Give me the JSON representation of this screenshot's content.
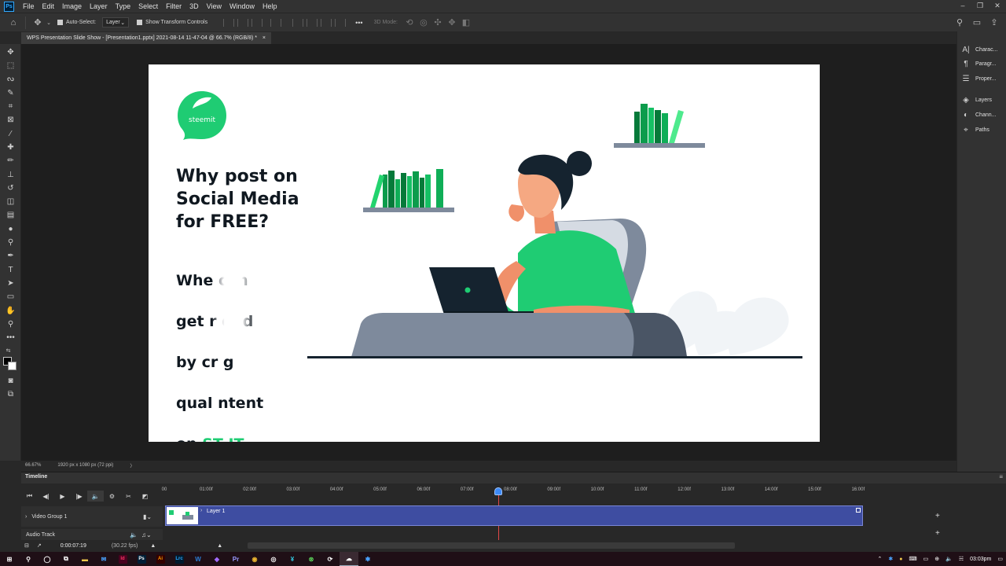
{
  "menu": {
    "app_icon": "Ps",
    "items": [
      "File",
      "Edit",
      "Image",
      "Layer",
      "Type",
      "Select",
      "Filter",
      "3D",
      "View",
      "Window",
      "Help"
    ],
    "window_controls": [
      "–",
      "❐",
      "✕"
    ]
  },
  "options_bar": {
    "auto_select_label": "Auto-Select:",
    "auto_select_target": "Layer",
    "transform_controls_label": "Show Transform Controls",
    "mode_3d_label": "3D Mode:",
    "more_label": "•••"
  },
  "document": {
    "tab_title": "WPS Presentation Slide Show - [Presentation1.pptx] 2021-08-14 11-47-04 @ 66.7% (RGB/8) *",
    "close_label": "×"
  },
  "slide": {
    "logo_text": "steemit",
    "headline": "Why post on\nSocial Media\nfor FREE?",
    "body_line1": "Whe     can",
    "body_line2": "get r    ded",
    "body_line3": "by cr    g",
    "body_line4": "qual    ntent",
    "body_line5_prefix": "on ",
    "body_line5_brand": "ST    IT.",
    "brand_color": "#1fcc73"
  },
  "status_bar": {
    "zoom": "66.67%",
    "doc_info": "1920 px x 1080 px (72 ppi)",
    "arrow": "〉"
  },
  "right_panels": [
    {
      "icon": "character-icon",
      "glyph": "A|",
      "label": "Charac..."
    },
    {
      "icon": "paragraph-icon",
      "glyph": "¶",
      "label": "Paragr..."
    },
    {
      "icon": "properties-icon",
      "glyph": "☰",
      "label": "Proper..."
    },
    {
      "icon": "layers-icon",
      "glyph": "◈",
      "label": "Layers"
    },
    {
      "icon": "channels-icon",
      "glyph": "◐",
      "label": "Chann..."
    },
    {
      "icon": "paths-icon",
      "glyph": "⌖",
      "label": "Paths"
    }
  ],
  "timeline": {
    "title": "Timeline",
    "ruler_ticks": [
      "00",
      "01:00f",
      "02:00f",
      "03:00f",
      "04:00f",
      "05:00f",
      "06:00f",
      "07:00f",
      "08:00f",
      "09:00f",
      "10:00f",
      "11:00f",
      "12:00f",
      "13:00f",
      "14:00f",
      "15:00f",
      "16:00f"
    ],
    "video_group_label": "Video Group 1",
    "layer_label": "Layer 1",
    "audio_track_label": "Audio Track",
    "timecode": "0:00:07:19",
    "fps": "(30.22 fps)",
    "playhead_seconds": 7.63
  },
  "taskbar": {
    "apps": [
      "Ps",
      "Ai",
      "Lrc"
    ],
    "time": "03:03pm",
    "colors": {
      "ps": "#31a8ff",
      "ai": "#ff9a00",
      "lrc": "#31a8ff"
    }
  }
}
